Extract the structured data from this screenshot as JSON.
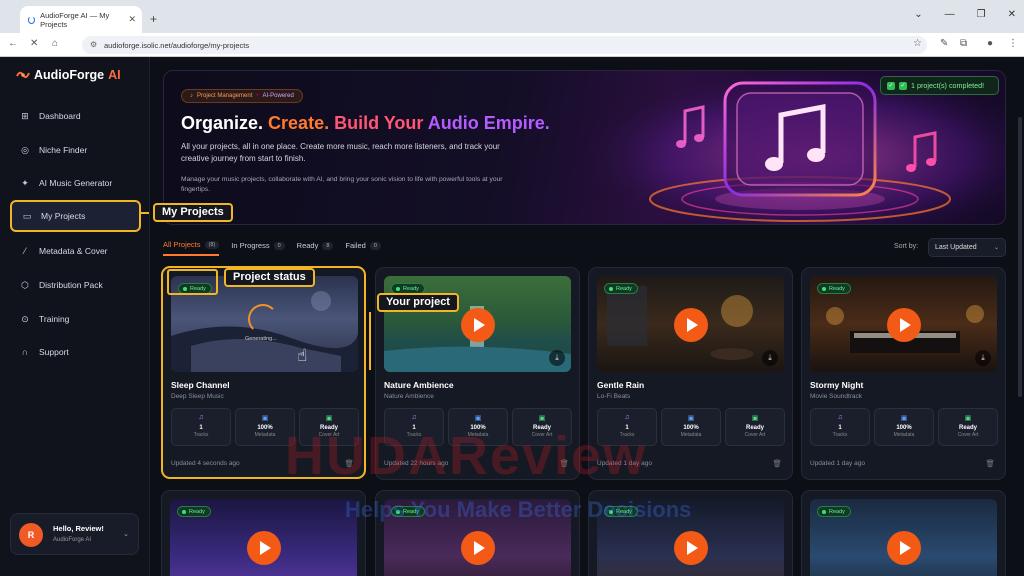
{
  "browser": {
    "tab_title": "AudioForge AI — My Projects",
    "url": "audioforge.isolic.net/audioforge/my-projects"
  },
  "sidebar": {
    "logo_text": "AudioForge",
    "logo_suffix": "AI",
    "items": [
      {
        "label": "Dashboard",
        "icon": "grid-icon"
      },
      {
        "label": "Niche Finder",
        "icon": "compass-icon"
      },
      {
        "label": "AI Music Generator",
        "icon": "sparkle-icon"
      },
      {
        "label": "My Projects",
        "icon": "folder-icon"
      },
      {
        "label": "Metadata & Cover",
        "icon": "wand-icon"
      },
      {
        "label": "Distribution Pack",
        "icon": "package-icon"
      },
      {
        "label": "Training",
        "icon": "play-circle-icon"
      },
      {
        "label": "Support",
        "icon": "headphones-icon"
      }
    ],
    "user": {
      "initial": "R",
      "greeting": "Hello, Review!",
      "app": "AudioForge AI"
    }
  },
  "hero": {
    "pill_left": "Project Management",
    "pill_right": "AI-Powered",
    "title_parts": [
      "Organize.",
      "Create.",
      "Build Your",
      "Audio Empire."
    ],
    "subtitle": "All your projects, all in one place. Create more music, reach more listeners, and track your creative journey from start to finish.",
    "subtitle2": "Manage your music projects, collaborate with AI, and bring your sonic vision to life with powerful tools at your fingertips."
  },
  "toast": "1 project(s) completed!",
  "filters": [
    {
      "label": "All Projects",
      "count": "(8)"
    },
    {
      "label": "In Progress",
      "count": "0"
    },
    {
      "label": "Ready",
      "count": "8"
    },
    {
      "label": "Failed",
      "count": "0"
    }
  ],
  "sort": {
    "label": "Sort by:",
    "value": "Last Updated"
  },
  "stat_labels": {
    "tracks": "Tracks",
    "metadata": "Metadata",
    "cover": "Cover Art"
  },
  "projects": [
    {
      "title": "Sleep Channel",
      "genre": "Deep Sleep Music",
      "status": "Ready",
      "tracks": "1",
      "metadata": "100%",
      "cover": "Ready",
      "updated": "Updated 4 seconds ago",
      "generating": "Generating..."
    },
    {
      "title": "Nature Ambience",
      "genre": "Nature Ambience",
      "status": "Ready",
      "tracks": "1",
      "metadata": "100%",
      "cover": "Ready",
      "updated": "Updated 22 hours ago"
    },
    {
      "title": "Gentle Rain",
      "genre": "Lo-Fi Beats",
      "status": "Ready",
      "tracks": "1",
      "metadata": "100%",
      "cover": "Ready",
      "updated": "Updated 1 day ago"
    },
    {
      "title": "Stormy Night",
      "genre": "Movie Soundtrack",
      "status": "Ready",
      "tracks": "1",
      "metadata": "100%",
      "cover": "Ready",
      "updated": "Updated 1 day ago"
    },
    {
      "status": "Ready"
    },
    {
      "status": "Ready"
    },
    {
      "status": "Ready"
    },
    {
      "status": "Ready"
    }
  ],
  "callouts": {
    "my_projects": "My Projects",
    "project_status": "Project status",
    "your_project": "Your project"
  },
  "watermark": {
    "line1": "HUDAReview",
    "line2": "Helps You Make Better Decisions"
  },
  "colors": {
    "accent": "#ff7a2e",
    "highlight": "#f2b625",
    "ready": "#3fe07a",
    "play": "#f25a16"
  }
}
